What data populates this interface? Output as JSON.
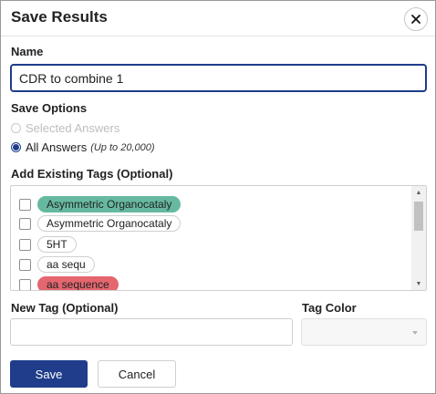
{
  "dialog": {
    "title": "Save Results",
    "close_icon": "close-icon"
  },
  "name": {
    "label": "Name",
    "value": "CDR to combine 1"
  },
  "save_options": {
    "label": "Save Options",
    "options": [
      {
        "label": "Selected Answers",
        "hint": "",
        "selected": false,
        "disabled": true
      },
      {
        "label": "All Answers",
        "hint": "(Up to 20,000)",
        "selected": true,
        "disabled": false
      }
    ]
  },
  "existing_tags": {
    "label": "Add Existing Tags (Optional)",
    "items": [
      {
        "label": "Asymmetric Organocataly",
        "color": "#66b9a0",
        "checked": false
      },
      {
        "label": "Asymmetric Organocataly",
        "color": "#ffffff",
        "checked": false
      },
      {
        "label": "5HT",
        "color": "#ffffff",
        "checked": false
      },
      {
        "label": "aa sequ",
        "color": "#ffffff",
        "checked": false
      },
      {
        "label": "aa sequence",
        "color": "#e4666f",
        "checked": false
      }
    ]
  },
  "new_tag": {
    "label": "New Tag (Optional)",
    "value": ""
  },
  "tag_color": {
    "label": "Tag Color",
    "value": ""
  },
  "buttons": {
    "save": "Save",
    "cancel": "Cancel"
  },
  "colors": {
    "primary": "#1f3d8a",
    "teal_tag": "#66b9a0",
    "red_tag": "#e4666f"
  }
}
